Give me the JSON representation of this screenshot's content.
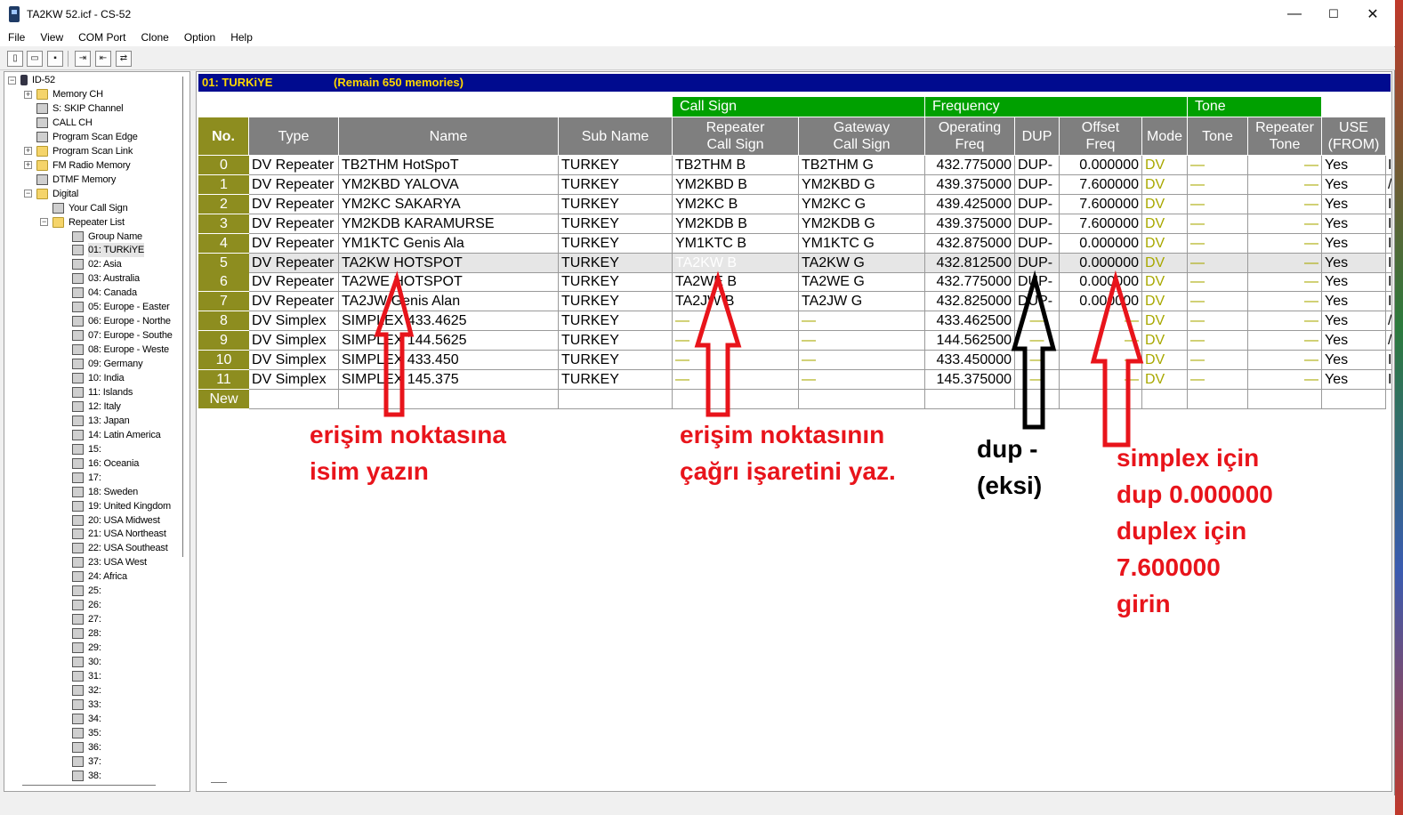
{
  "window": {
    "title": "TA2KW 52.icf - CS-52",
    "controls": {
      "minimize": "—",
      "maximize": "☐",
      "close": "✕"
    }
  },
  "menu": [
    "File",
    "View",
    "COM Port",
    "Clone",
    "Option",
    "Help"
  ],
  "toolbar": {
    "buttons": [
      {
        "name": "new-icon",
        "glyph": "▯"
      },
      {
        "name": "open-icon",
        "glyph": "▭"
      },
      {
        "name": "save-icon",
        "glyph": "▪"
      },
      {
        "name": "read-from-radio-icon",
        "glyph": "⇥"
      },
      {
        "name": "write-to-radio-icon",
        "glyph": "⇤"
      },
      {
        "name": "clone-icon",
        "glyph": "⇄"
      }
    ]
  },
  "tree": {
    "root": "ID-52",
    "items": [
      {
        "label": "Memory CH",
        "level": 1,
        "icon": "folder",
        "expander": "+"
      },
      {
        "label": "S: SKIP Channel",
        "level": 1,
        "icon": "doc"
      },
      {
        "label": "CALL CH",
        "level": 1,
        "icon": "doc"
      },
      {
        "label": "Program Scan Edge",
        "level": 1,
        "icon": "doc"
      },
      {
        "label": "Program Scan Link",
        "level": 1,
        "icon": "folder",
        "expander": "+"
      },
      {
        "label": "FM Radio Memory",
        "level": 1,
        "icon": "folder",
        "expander": "+"
      },
      {
        "label": "DTMF Memory",
        "level": 1,
        "icon": "doc"
      },
      {
        "label": "Digital",
        "level": 1,
        "icon": "folder",
        "expander": "−"
      },
      {
        "label": "Your Call Sign",
        "level": 2,
        "icon": "doc"
      },
      {
        "label": "Repeater List",
        "level": 2,
        "icon": "folder",
        "expander": "−"
      },
      {
        "label": "Group Name",
        "level": 3,
        "icon": "doc"
      },
      {
        "label": "01: TURKiYE",
        "level": 3,
        "icon": "doc",
        "selected": true
      },
      {
        "label": "02: Asia",
        "level": 3,
        "icon": "doc"
      },
      {
        "label": "03: Australia",
        "level": 3,
        "icon": "doc"
      },
      {
        "label": "04: Canada",
        "level": 3,
        "icon": "doc"
      },
      {
        "label": "05: Europe - Easter",
        "level": 3,
        "icon": "doc"
      },
      {
        "label": "06: Europe - Northe",
        "level": 3,
        "icon": "doc"
      },
      {
        "label": "07: Europe - Southe",
        "level": 3,
        "icon": "doc"
      },
      {
        "label": "08: Europe - Weste",
        "level": 3,
        "icon": "doc"
      },
      {
        "label": "09: Germany",
        "level": 3,
        "icon": "doc"
      },
      {
        "label": "10: India",
        "level": 3,
        "icon": "doc"
      },
      {
        "label": "11: Islands",
        "level": 3,
        "icon": "doc"
      },
      {
        "label": "12: Italy",
        "level": 3,
        "icon": "doc"
      },
      {
        "label": "13: Japan",
        "level": 3,
        "icon": "doc"
      },
      {
        "label": "14: Latin America",
        "level": 3,
        "icon": "doc"
      },
      {
        "label": "15:",
        "level": 3,
        "icon": "doc"
      },
      {
        "label": "16: Oceania",
        "level": 3,
        "icon": "doc"
      },
      {
        "label": "17:",
        "level": 3,
        "icon": "doc"
      },
      {
        "label": "18: Sweden",
        "level": 3,
        "icon": "doc"
      },
      {
        "label": "19: United Kingdom",
        "level": 3,
        "icon": "doc"
      },
      {
        "label": "20: USA Midwest",
        "level": 3,
        "icon": "doc"
      },
      {
        "label": "21: USA Northeast",
        "level": 3,
        "icon": "doc"
      },
      {
        "label": "22: USA Southeast",
        "level": 3,
        "icon": "doc"
      },
      {
        "label": "23: USA West",
        "level": 3,
        "icon": "doc"
      },
      {
        "label": "24: Africa",
        "level": 3,
        "icon": "doc"
      },
      {
        "label": "25:",
        "level": 3,
        "icon": "doc"
      },
      {
        "label": "26:",
        "level": 3,
        "icon": "doc"
      },
      {
        "label": "27:",
        "level": 3,
        "icon": "doc"
      },
      {
        "label": "28:",
        "level": 3,
        "icon": "doc"
      },
      {
        "label": "29:",
        "level": 3,
        "icon": "doc"
      },
      {
        "label": "30:",
        "level": 3,
        "icon": "doc"
      },
      {
        "label": "31:",
        "level": 3,
        "icon": "doc"
      },
      {
        "label": "32:",
        "level": 3,
        "icon": "doc"
      },
      {
        "label": "33:",
        "level": 3,
        "icon": "doc"
      },
      {
        "label": "34:",
        "level": 3,
        "icon": "doc"
      },
      {
        "label": "35:",
        "level": 3,
        "icon": "doc"
      },
      {
        "label": "36:",
        "level": 3,
        "icon": "doc"
      },
      {
        "label": "37:",
        "level": 3,
        "icon": "doc"
      },
      {
        "label": "38:",
        "level": 3,
        "icon": "doc"
      }
    ]
  },
  "main": {
    "group_title": "01: TURKiYE",
    "remain": "(Remain 650 memories)",
    "groups": {
      "callsign": "Call Sign",
      "frequency": "Frequency",
      "tone": "Tone"
    },
    "columns": [
      {
        "key": "no",
        "label": "No."
      },
      {
        "key": "type",
        "label": "Type"
      },
      {
        "key": "name",
        "label": "Name"
      },
      {
        "key": "sub",
        "label": "Sub Name"
      },
      {
        "key": "rpt",
        "label": "Repeater",
        "label2": "Call Sign"
      },
      {
        "key": "gw",
        "label": "Gateway",
        "label2": "Call Sign"
      },
      {
        "key": "freq",
        "label": "Operating",
        "label2": "Freq"
      },
      {
        "key": "dup",
        "label": "DUP"
      },
      {
        "key": "offset",
        "label": "Offset",
        "label2": "Freq"
      },
      {
        "key": "mode",
        "label": "Mode"
      },
      {
        "key": "tone",
        "label": "Tone"
      },
      {
        "key": "rtone",
        "label": "Repeater",
        "label2": "Tone"
      },
      {
        "key": "use",
        "label": "USE",
        "label2": "(FROM)"
      }
    ],
    "rows": [
      {
        "no": "0",
        "type": "DV Repeater",
        "name": "TB2THM HotSpoT",
        "sub": "TURKEY",
        "rpt": "TB2THM B",
        "gw": "TB2THM G",
        "freq": "432.775000",
        "dup": "DUP-",
        "offset": "0.000000",
        "mode": "DV",
        "tone": "—",
        "rtone": "—",
        "use": "Yes",
        "extra": "I"
      },
      {
        "no": "1",
        "type": "DV Repeater",
        "name": "YM2KBD YALOVA",
        "sub": "TURKEY",
        "rpt": "YM2KBD B",
        "gw": "YM2KBD G",
        "freq": "439.375000",
        "dup": "DUP-",
        "offset": "7.600000",
        "mode": "DV",
        "tone": "—",
        "rtone": "—",
        "use": "Yes",
        "extra": "/"
      },
      {
        "no": "2",
        "type": "DV Repeater",
        "name": "YM2KC SAKARYA",
        "sub": "TURKEY",
        "rpt": "YM2KC  B",
        "gw": "YM2KC  G",
        "freq": "439.425000",
        "dup": "DUP-",
        "offset": "7.600000",
        "mode": "DV",
        "tone": "—",
        "rtone": "—",
        "use": "Yes",
        "extra": "I"
      },
      {
        "no": "3",
        "type": "DV Repeater",
        "name": "YM2KDB KARAMURSE",
        "sub": "TURKEY",
        "rpt": "YM2KDB B",
        "gw": "YM2KDB G",
        "freq": "439.375000",
        "dup": "DUP-",
        "offset": "7.600000",
        "mode": "DV",
        "tone": "—",
        "rtone": "—",
        "use": "Yes",
        "extra": "I"
      },
      {
        "no": "4",
        "type": "DV Repeater",
        "name": "YM1KTC Genis Ala",
        "sub": "TURKEY",
        "rpt": "YM1KTC B",
        "gw": "YM1KTC G",
        "freq": "432.875000",
        "dup": "DUP-",
        "offset": "0.000000",
        "mode": "DV",
        "tone": "—",
        "rtone": "—",
        "use": "Yes",
        "extra": "I"
      },
      {
        "no": "5",
        "type": "DV Repeater",
        "name": "TA2KW HOTSPOT",
        "sub": "TURKEY",
        "rpt": "TA2KW  B",
        "gw": "TA2KW  G",
        "freq": "432.812500",
        "dup": "DUP-",
        "offset": "0.000000",
        "mode": "DV",
        "tone": "—",
        "rtone": "—",
        "use": "Yes",
        "extra": "I",
        "selected": true
      },
      {
        "no": "6",
        "type": "DV Repeater",
        "name": "TA2WE HOTSPOT",
        "sub": "TURKEY",
        "rpt": "TA2WE  B",
        "gw": "TA2WE  G",
        "freq": "432.775000",
        "dup": "DUP-",
        "offset": "0.000000",
        "mode": "DV",
        "tone": "—",
        "rtone": "—",
        "use": "Yes",
        "extra": "I"
      },
      {
        "no": "7",
        "type": "DV Repeater",
        "name": "TA2JW Genis Alan",
        "sub": "TURKEY",
        "rpt": "TA2JW  B",
        "gw": "TA2JW  G",
        "freq": "432.825000",
        "dup": "DUP-",
        "offset": "0.000000",
        "mode": "DV",
        "tone": "—",
        "rtone": "—",
        "use": "Yes",
        "extra": "I"
      },
      {
        "no": "8",
        "type": "DV Simplex",
        "name": "SIMPLEX 433.4625",
        "sub": "TURKEY",
        "rpt": "—",
        "gw": "—",
        "freq": "433.462500",
        "dup": "—",
        "offset": "—",
        "mode": "DV",
        "tone": "—",
        "rtone": "—",
        "use": "Yes",
        "extra": "/"
      },
      {
        "no": "9",
        "type": "DV Simplex",
        "name": "SIMPLEX 144.5625",
        "sub": "TURKEY",
        "rpt": "—",
        "gw": "—",
        "freq": "144.562500",
        "dup": "—",
        "offset": "—",
        "mode": "DV",
        "tone": "—",
        "rtone": "—",
        "use": "Yes",
        "extra": "/"
      },
      {
        "no": "10",
        "type": "DV Simplex",
        "name": "SIMPLEX 433.450",
        "sub": "TURKEY",
        "rpt": "—",
        "gw": "—",
        "freq": "433.450000",
        "dup": "—",
        "offset": "—",
        "mode": "DV",
        "tone": "—",
        "rtone": "—",
        "use": "Yes",
        "extra": "I"
      },
      {
        "no": "11",
        "type": "DV Simplex",
        "name": "SIMPLEX 145.375",
        "sub": "TURKEY",
        "rpt": "—",
        "gw": "—",
        "freq": "145.375000",
        "dup": "—",
        "offset": "—",
        "mode": "DV",
        "tone": "—",
        "rtone": "—",
        "use": "Yes",
        "extra": "I"
      }
    ],
    "new_row_label": "New"
  },
  "annotations": {
    "name_hint": [
      "erişim noktasına",
      "isim yazın"
    ],
    "callsign_hint": [
      "erişim noktasının",
      "çağrı işaretini yaz."
    ],
    "dup_hint": [
      "dup -",
      "(eksi)"
    ],
    "offset_hint": [
      "simplex için",
      "dup 0.000000",
      "duplex için",
      "7.600000",
      "girin"
    ]
  },
  "colors": {
    "accent_red": "#e8141b",
    "group_green": "#00a000",
    "header_gray": "#7f7f7f",
    "number_olive": "#8d8d1f",
    "title_bar_blue": "#000b8f",
    "title_text_yellow": "#ffd800",
    "selection_blue": "#0060d8"
  }
}
